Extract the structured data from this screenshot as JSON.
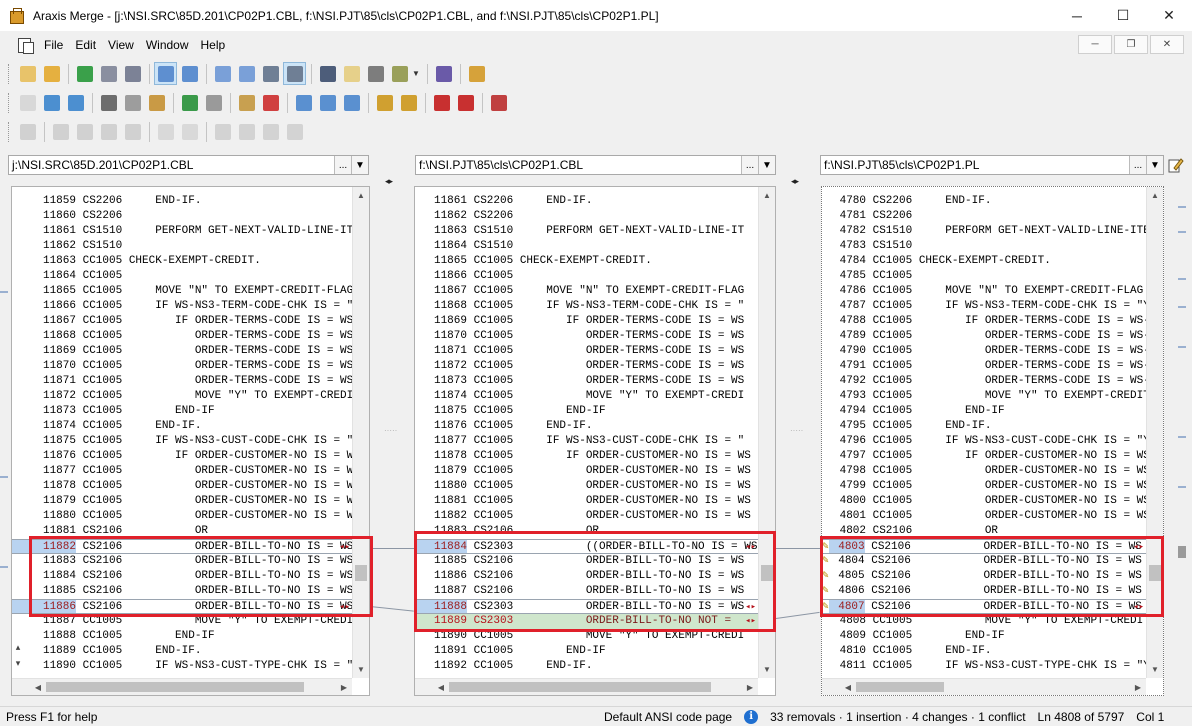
{
  "window": {
    "title": "Araxis Merge - [j:\\NSI.SRC\\85D.201\\CP02P1.CBL, f:\\NSI.PJT\\85\\cls\\CP02P1.CBL, and f:\\NSI.PJT\\85\\cls\\CP02P1.PL]",
    "minimize": "─",
    "maximize": "☐",
    "close": "✕"
  },
  "menu": {
    "items": [
      "File",
      "Edit",
      "View",
      "Window",
      "Help"
    ],
    "mdi": {
      "minimize": "─",
      "restore": "❐",
      "close": "✕"
    }
  },
  "toolbars": {
    "row1": [
      "new-comparison",
      "open-folder",
      "refresh",
      "save",
      "save-all",
      "prev-change",
      "next-change",
      "two-way",
      "three-way",
      "horizontal-layout",
      "side-by-side",
      "summary-report",
      "bookmark",
      "print",
      "options",
      "help-book",
      "home"
    ],
    "row2": [
      "new-doc",
      "import",
      "swap",
      "cut",
      "copy",
      "paste",
      "undo",
      "redo",
      "insert-text",
      "check",
      "merge-left",
      "merge-center",
      "merge-right",
      "edit-pen",
      "edit-down",
      "bullet-add",
      "bullet-remove",
      "settings-tools"
    ],
    "row3": [
      "stop",
      "grid-a",
      "grid-b",
      "grid-c",
      "grid-d",
      "page",
      "page-edit",
      "export",
      "import2",
      "cross",
      "clock"
    ]
  },
  "panes": [
    {
      "path": "j:\\NSI.SRC\\85D.201\\CP02P1.CBL",
      "browse": "...",
      "drop": "▼",
      "lines": [
        {
          "n": "11859",
          "code": "CS2206",
          "text": "    END-IF."
        },
        {
          "n": "11860",
          "code": "CS2206",
          "text": ""
        },
        {
          "n": "11861",
          "code": "CS1510",
          "text": "    PERFORM GET-NEXT-VALID-LINE-IT"
        },
        {
          "n": "11862",
          "code": "CS1510",
          "text": ""
        },
        {
          "n": "11863",
          "code": "CC1005",
          "text": "CHECK-EXEMPT-CREDIT."
        },
        {
          "n": "11864",
          "code": "CC1005",
          "text": ""
        },
        {
          "n": "11865",
          "code": "CC1005",
          "text": "    MOVE \"N\" TO EXEMPT-CREDIT-FLAG"
        },
        {
          "n": "11866",
          "code": "CC1005",
          "text": "    IF WS-NS3-TERM-CODE-CHK IS = \""
        },
        {
          "n": "11867",
          "code": "CC1005",
          "text": "       IF ORDER-TERMS-CODE IS = WS"
        },
        {
          "n": "11868",
          "code": "CC1005",
          "text": "          ORDER-TERMS-CODE IS = WS"
        },
        {
          "n": "11869",
          "code": "CC1005",
          "text": "          ORDER-TERMS-CODE IS = WS"
        },
        {
          "n": "11870",
          "code": "CC1005",
          "text": "          ORDER-TERMS-CODE IS = WS"
        },
        {
          "n": "11871",
          "code": "CC1005",
          "text": "          ORDER-TERMS-CODE IS = WS"
        },
        {
          "n": "11872",
          "code": "CC1005",
          "text": "          MOVE \"Y\" TO EXEMPT-CREDI"
        },
        {
          "n": "11873",
          "code": "CC1005",
          "text": "       END-IF"
        },
        {
          "n": "11874",
          "code": "CC1005",
          "text": "    END-IF."
        },
        {
          "n": "11875",
          "code": "CC1005",
          "text": "    IF WS-NS3-CUST-CODE-CHK IS = \""
        },
        {
          "n": "11876",
          "code": "CC1005",
          "text": "       IF ORDER-CUSTOMER-NO IS = WS"
        },
        {
          "n": "11877",
          "code": "CC1005",
          "text": "          ORDER-CUSTOMER-NO IS = WS"
        },
        {
          "n": "11878",
          "code": "CC1005",
          "text": "          ORDER-CUSTOMER-NO IS = WS"
        },
        {
          "n": "11879",
          "code": "CC1005",
          "text": "          ORDER-CUSTOMER-NO IS = WS"
        },
        {
          "n": "11880",
          "code": "CC1005",
          "text": "          ORDER-CUSTOMER-NO IS = WS"
        },
        {
          "n": "11881",
          "code": "CS2106",
          "text": "          OR"
        },
        {
          "n": "11882",
          "code": "CS2106",
          "text": "          ORDER-BILL-TO-NO IS = WS",
          "type": "chg-top"
        },
        {
          "n": "11883",
          "code": "CS2106",
          "text": "          ORDER-BILL-TO-NO IS = WS",
          "type": "mid"
        },
        {
          "n": "11884",
          "code": "CS2106",
          "text": "          ORDER-BILL-TO-NO IS = WS",
          "type": "mid"
        },
        {
          "n": "11885",
          "code": "CS2106",
          "text": "          ORDER-BILL-TO-NO IS = WS",
          "type": "mid"
        },
        {
          "n": "11886",
          "code": "CS2106",
          "text": "          ORDER-BILL-TO-NO IS = WS",
          "type": "chg-bot"
        },
        {
          "n": "11887",
          "code": "CC1005",
          "text": "          MOVE \"Y\" TO EXEMPT-CREDI"
        },
        {
          "n": "11888",
          "code": "CC1005",
          "text": "       END-IF"
        },
        {
          "n": "11889",
          "code": "CC1005",
          "text": "    END-IF."
        },
        {
          "n": "11890",
          "code": "CC1005",
          "text": "    IF WS-NS3-CUST-TYPE-CHK IS = \""
        }
      ]
    },
    {
      "path": "f:\\NSI.PJT\\85\\cls\\CP02P1.CBL",
      "browse": "...",
      "drop": "▼",
      "lines": [
        {
          "n": "11861",
          "code": "CS2206",
          "text": "    END-IF."
        },
        {
          "n": "11862",
          "code": "CS2206",
          "text": ""
        },
        {
          "n": "11863",
          "code": "CS1510",
          "text": "    PERFORM GET-NEXT-VALID-LINE-IT"
        },
        {
          "n": "11864",
          "code": "CS1510",
          "text": ""
        },
        {
          "n": "11865",
          "code": "CC1005",
          "text": "CHECK-EXEMPT-CREDIT."
        },
        {
          "n": "11866",
          "code": "CC1005",
          "text": ""
        },
        {
          "n": "11867",
          "code": "CC1005",
          "text": "    MOVE \"N\" TO EXEMPT-CREDIT-FLAG"
        },
        {
          "n": "11868",
          "code": "CC1005",
          "text": "    IF WS-NS3-TERM-CODE-CHK IS = \""
        },
        {
          "n": "11869",
          "code": "CC1005",
          "text": "       IF ORDER-TERMS-CODE IS = WS"
        },
        {
          "n": "11870",
          "code": "CC1005",
          "text": "          ORDER-TERMS-CODE IS = WS"
        },
        {
          "n": "11871",
          "code": "CC1005",
          "text": "          ORDER-TERMS-CODE IS = WS"
        },
        {
          "n": "11872",
          "code": "CC1005",
          "text": "          ORDER-TERMS-CODE IS = WS"
        },
        {
          "n": "11873",
          "code": "CC1005",
          "text": "          ORDER-TERMS-CODE IS = WS"
        },
        {
          "n": "11874",
          "code": "CC1005",
          "text": "          MOVE \"Y\" TO EXEMPT-CREDI"
        },
        {
          "n": "11875",
          "code": "CC1005",
          "text": "       END-IF"
        },
        {
          "n": "11876",
          "code": "CC1005",
          "text": "    END-IF."
        },
        {
          "n": "11877",
          "code": "CC1005",
          "text": "    IF WS-NS3-CUST-CODE-CHK IS = \""
        },
        {
          "n": "11878",
          "code": "CC1005",
          "text": "       IF ORDER-CUSTOMER-NO IS = WS"
        },
        {
          "n": "11879",
          "code": "CC1005",
          "text": "          ORDER-CUSTOMER-NO IS = WS"
        },
        {
          "n": "11880",
          "code": "CC1005",
          "text": "          ORDER-CUSTOMER-NO IS = WS"
        },
        {
          "n": "11881",
          "code": "CC1005",
          "text": "          ORDER-CUSTOMER-NO IS = WS"
        },
        {
          "n": "11882",
          "code": "CC1005",
          "text": "          ORDER-CUSTOMER-NO IS = WS"
        },
        {
          "n": "11883",
          "code": "CS2106",
          "text": "          OR"
        },
        {
          "n": "11884",
          "code": "CS2303",
          "text": "          ((ORDER-BILL-TO-NO IS = WS",
          "type": "chg-top"
        },
        {
          "n": "11885",
          "code": "CS2106",
          "text": "          ORDER-BILL-TO-NO IS = WS",
          "type": "mid"
        },
        {
          "n": "11886",
          "code": "CS2106",
          "text": "          ORDER-BILL-TO-NO IS = WS",
          "type": "mid"
        },
        {
          "n": "11887",
          "code": "CS2106",
          "text": "          ORDER-BILL-TO-NO IS = WS",
          "type": "mid"
        },
        {
          "n": "11888",
          "code": "CS2303",
          "text": "          ORDER-BILL-TO-NO IS = WS",
          "type": "chg-bot"
        },
        {
          "n": "11889",
          "code": "CS2303",
          "text": "          ORDER-BILL-TO-NO NOT = ",
          "type": "ins"
        },
        {
          "n": "11890",
          "code": "CC1005",
          "text": "          MOVE \"Y\" TO EXEMPT-CREDI"
        },
        {
          "n": "11891",
          "code": "CC1005",
          "text": "       END-IF"
        },
        {
          "n": "11892",
          "code": "CC1005",
          "text": "    END-IF."
        }
      ]
    },
    {
      "path": "f:\\NSI.PJT\\85\\cls\\CP02P1.PL",
      "browse": "...",
      "drop": "▼",
      "lines": [
        {
          "n": "4780",
          "code": "CS2206",
          "text": "    END-IF."
        },
        {
          "n": "4781",
          "code": "CS2206",
          "text": ""
        },
        {
          "n": "4782",
          "code": "CS1510",
          "text": "    PERFORM GET-NEXT-VALID-LINE-ITE"
        },
        {
          "n": "4783",
          "code": "CS1510",
          "text": ""
        },
        {
          "n": "4784",
          "code": "CC1005",
          "text": "CHECK-EXEMPT-CREDIT."
        },
        {
          "n": "4785",
          "code": "CC1005",
          "text": ""
        },
        {
          "n": "4786",
          "code": "CC1005",
          "text": "    MOVE \"N\" TO EXEMPT-CREDIT-FLAG"
        },
        {
          "n": "4787",
          "code": "CC1005",
          "text": "    IF WS-NS3-TERM-CODE-CHK IS = \"Y"
        },
        {
          "n": "4788",
          "code": "CC1005",
          "text": "       IF ORDER-TERMS-CODE IS = WS-"
        },
        {
          "n": "4789",
          "code": "CC1005",
          "text": "          ORDER-TERMS-CODE IS = WS-"
        },
        {
          "n": "4790",
          "code": "CC1005",
          "text": "          ORDER-TERMS-CODE IS = WS-"
        },
        {
          "n": "4791",
          "code": "CC1005",
          "text": "          ORDER-TERMS-CODE IS = WS-"
        },
        {
          "n": "4792",
          "code": "CC1005",
          "text": "          ORDER-TERMS-CODE IS = WS-"
        },
        {
          "n": "4793",
          "code": "CC1005",
          "text": "          MOVE \"Y\" TO EXEMPT-CREDIT"
        },
        {
          "n": "4794",
          "code": "CC1005",
          "text": "       END-IF"
        },
        {
          "n": "4795",
          "code": "CC1005",
          "text": "    END-IF."
        },
        {
          "n": "4796",
          "code": "CC1005",
          "text": "    IF WS-NS3-CUST-CODE-CHK IS = \"Y"
        },
        {
          "n": "4797",
          "code": "CC1005",
          "text": "       IF ORDER-CUSTOMER-NO IS = WS"
        },
        {
          "n": "4798",
          "code": "CC1005",
          "text": "          ORDER-CUSTOMER-NO IS = WS"
        },
        {
          "n": "4799",
          "code": "CC1005",
          "text": "          ORDER-CUSTOMER-NO IS = WS"
        },
        {
          "n": "4800",
          "code": "CC1005",
          "text": "          ORDER-CUSTOMER-NO IS = WS"
        },
        {
          "n": "4801",
          "code": "CC1005",
          "text": "          ORDER-CUSTOMER-NO IS = WS"
        },
        {
          "n": "4802",
          "code": "CS2106",
          "text": "          OR"
        },
        {
          "n": "4803",
          "code": "CS2106",
          "text": "          ORDER-BILL-TO-NO IS = WS",
          "type": "chg-top",
          "pen": true
        },
        {
          "n": "4804",
          "code": "CS2106",
          "text": "          ORDER-BILL-TO-NO IS = WS",
          "type": "mid",
          "pen": true
        },
        {
          "n": "4805",
          "code": "CS2106",
          "text": "          ORDER-BILL-TO-NO IS = WS",
          "type": "mid",
          "pen": true
        },
        {
          "n": "4806",
          "code": "CS2106",
          "text": "          ORDER-BILL-TO-NO IS = WS",
          "type": "mid",
          "pen": true
        },
        {
          "n": "4807",
          "code": "CS2106",
          "text": "          ORDER-BILL-TO-NO IS = WS",
          "type": "chg-bot",
          "pen": true
        },
        {
          "n": "4808",
          "code": "CC1005",
          "text": "          MOVE \"Y\" TO EXEMPT-CREDIT"
        },
        {
          "n": "4809",
          "code": "CC1005",
          "text": "       END-IF"
        },
        {
          "n": "4810",
          "code": "CC1005",
          "text": "    END-IF."
        },
        {
          "n": "4811",
          "code": "CC1005",
          "text": "    IF WS-NS3-CUST-TYPE-CHK IS = \"Y"
        }
      ]
    }
  ],
  "link_arrows": "◂▸",
  "status": {
    "help": "Press F1 for help",
    "encoding": "Default ANSI code page",
    "info": "i",
    "summary": "33 removals · 1 insertion · 4 changes · 1 conflict",
    "position": "Ln 4808 of 5797",
    "column": "Col 1"
  },
  "colors": {
    "change_number_bg": "#b9d3f0",
    "insert_bg": "#cfe6cc",
    "highlight_red": "#e0202a"
  }
}
